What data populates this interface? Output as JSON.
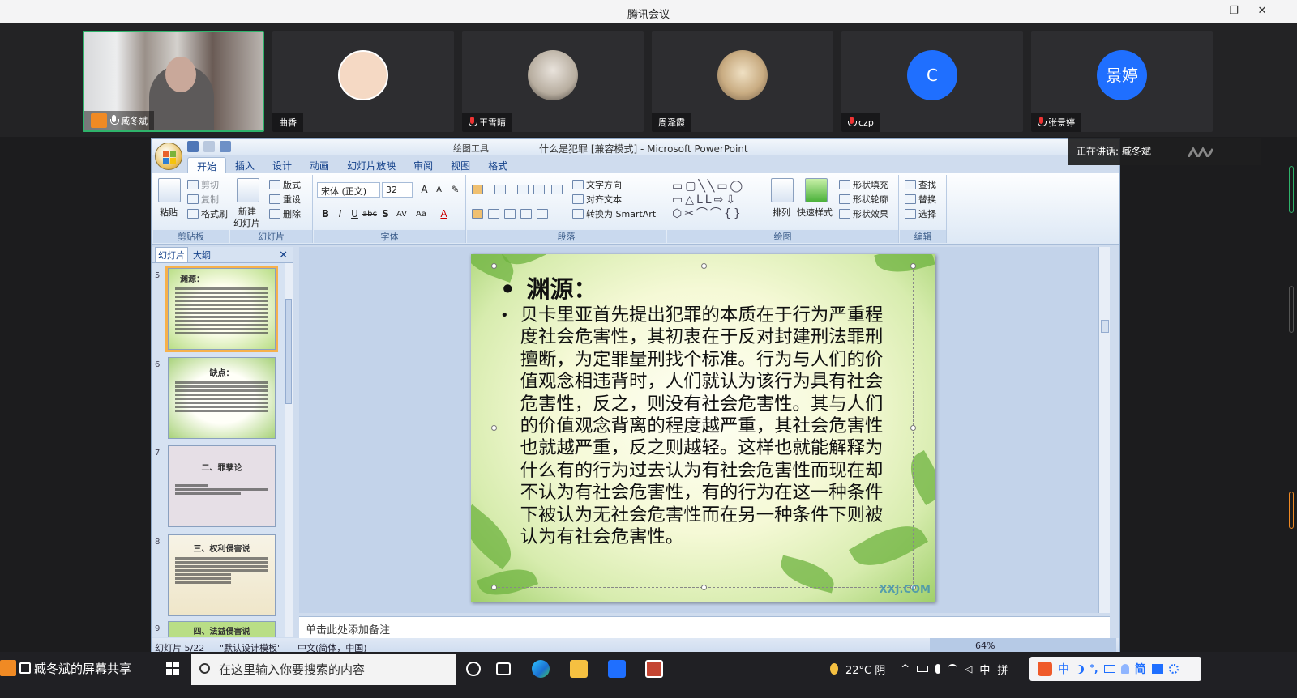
{
  "window": {
    "title": "腾讯会议",
    "controls": [
      "–",
      "❐",
      "✕"
    ]
  },
  "participants": [
    {
      "name": "臧冬斌",
      "type": "video",
      "muted": false,
      "active": true
    },
    {
      "name": "曲香",
      "type": "photo",
      "muted": null,
      "active": false,
      "avatar_color": "#f5d9c4"
    },
    {
      "name": "王雪晴",
      "type": "photo",
      "muted": true,
      "active": false,
      "avatar_color": "#d8cfc6"
    },
    {
      "name": "周泽霞",
      "type": "photo",
      "muted": null,
      "active": false,
      "avatar_color": "#c9b79c"
    },
    {
      "name": "czp",
      "type": "letter",
      "letter": "C",
      "muted": true,
      "active": false,
      "avatar_color": "#1f6fff"
    },
    {
      "name": "张景婷",
      "type": "letter",
      "letter": "景婷",
      "muted": true,
      "active": false,
      "avatar_color": "#1f6fff"
    }
  ],
  "speaking": {
    "label": "正在讲话: 臧冬斌"
  },
  "powerpoint": {
    "context_tools": "绘图工具",
    "document_title": "什么是犯罪 [兼容模式] - Microsoft PowerPoint",
    "tabs": [
      "开始",
      "插入",
      "设计",
      "动画",
      "幻灯片放映",
      "审阅",
      "视图",
      "格式"
    ],
    "active_tab": "开始",
    "ribbon": {
      "clipboard": {
        "name": "剪贴板",
        "paste": "粘贴",
        "cut": "剪切",
        "copy": "复制",
        "format_painter": "格式刷"
      },
      "slides": {
        "name": "幻灯片",
        "new_slide": "新建",
        "new_slide_2": "幻灯片",
        "layout": "版式",
        "reset": "重设",
        "delete": "删除"
      },
      "font": {
        "name": "字体",
        "font_name": "宋体 (正文)",
        "font_size": "32"
      },
      "paragraph": {
        "name": "段落",
        "text_direction": "文字方向",
        "align_text": "对齐文本",
        "smartart": "转换为 SmartArt"
      },
      "drawing": {
        "name": "绘图",
        "arrange": "排列",
        "quick_styles": "快速样式",
        "shape_fill": "形状填充",
        "shape_outline": "形状轮廓",
        "shape_effects": "形状效果"
      },
      "editing": {
        "name": "编辑",
        "find": "查找",
        "replace": "替换",
        "select": "选择"
      }
    },
    "pane": {
      "tab_slides": "幻灯片",
      "tab_outline": "大纲",
      "close": "✕",
      "thumbs": [
        {
          "num": "5",
          "title": "渊源：",
          "selected": true
        },
        {
          "num": "6",
          "title": "缺点：",
          "selected": false
        },
        {
          "num": "7",
          "title": "二、罪孽论",
          "selected": false
        },
        {
          "num": "8",
          "title": "三、权利侵害说",
          "selected": false
        },
        {
          "num": "9",
          "title": "四、法益侵害说",
          "selected": false
        }
      ]
    },
    "slide": {
      "bullet": "•",
      "title": "渊源：",
      "body": "贝卡里亚首先提出犯罪的本质在于行为严重程度社会危害性，其初衷在于反对封建刑法罪刑擅断，为定罪量刑找个标准。行为与人们的价值观念相违背时，人们就认为该行为具有社会危害性，反之，则没有社会危害性。其与人们的价值观念背离的程度越严重，其社会危害性也就越严重，反之则越轻。这样也就能解释为什么有的行为过去认为有社会危害性而现在却不认为有社会危害性，有的行为在这一种条件下被认为无社会危害性而在另一种条件下则被认为有社会危害性。",
      "watermark": "XXJ.COM"
    },
    "notes_placeholder": "单击此处添加备注",
    "status": {
      "slide_pos": "幻灯片 5/22",
      "theme": "\"默认设计模板\"",
      "language": "中文(简体，中国)",
      "zoom": "64%"
    }
  },
  "taskbar": {
    "share_label": "臧冬斌的屏幕共享",
    "search_placeholder": "在这里输入你要搜索的内容",
    "weather": "22°C 阴",
    "ime_lang": "中",
    "ime_mode": "拼",
    "ime_zh": "中",
    "ime_simplified": "简"
  }
}
